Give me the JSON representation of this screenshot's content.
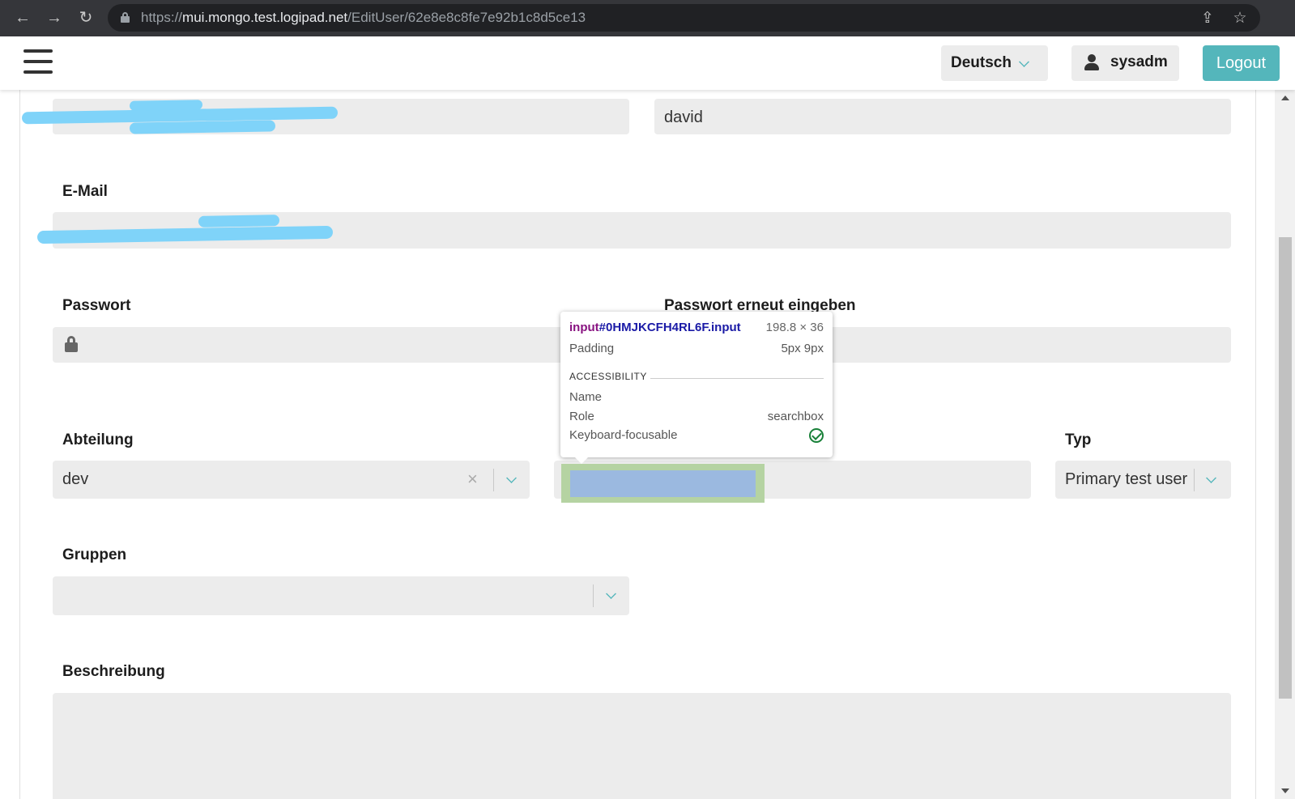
{
  "browser": {
    "url_scheme": "https://",
    "url_host": "mui.mongo.test.logipad.net",
    "url_path": "/EditUser/62e8e8c8fe7e92b1c8d5ce13",
    "back_icon": "←",
    "forward_icon": "→",
    "reload_icon": "↻",
    "share_icon": "⇪",
    "bookmark_icon": "☆"
  },
  "header": {
    "language_label": "Deutsch",
    "username": "sysadm",
    "logout_label": "Logout",
    "accent_color": "#54b6bb"
  },
  "form": {
    "lastname_value": "david",
    "email_label": "E-Mail",
    "password_label": "Passwort",
    "password_repeat_label": "Passwort erneut eingeben",
    "department_label": "Abteilung",
    "department_value": "dev",
    "department_clear_icon": "×",
    "type_label": "Typ",
    "type_value": "Primary test user",
    "groups_label": "Gruppen",
    "description_label": "Beschreibung"
  },
  "devtools_tooltip": {
    "selector_tag": "input",
    "selector_id": "#0HMJKCFH4RL6F.input",
    "dimensions": "198.8 × 36",
    "padding_label": "Padding",
    "padding_value": "5px 9px",
    "section_title": "ACCESSIBILITY",
    "name_label": "Name",
    "role_label": "Role",
    "role_value": "searchbox",
    "focusable_label": "Keyboard-focusable"
  }
}
